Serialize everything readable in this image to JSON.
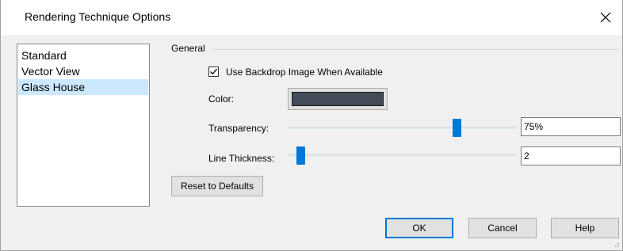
{
  "window": {
    "title": "Rendering Technique Options",
    "close_icon": "close-icon"
  },
  "techniques": {
    "items": [
      {
        "label": "Standard",
        "selected": false
      },
      {
        "label": "Vector View",
        "selected": false
      },
      {
        "label": "Glass House",
        "selected": true
      }
    ]
  },
  "general": {
    "group_label": "General",
    "backdrop": {
      "label": "Use Backdrop Image When Available",
      "checked": true
    },
    "color": {
      "label": "Color:",
      "value": "#434a58"
    },
    "transparency": {
      "label": "Transparency:",
      "value_text": "75%",
      "slider_fraction": 0.75
    },
    "line_thickness": {
      "label": "Line Thickness:",
      "value_text": "2",
      "slider_fraction": 0.04
    }
  },
  "buttons": {
    "reset": "Reset to Defaults",
    "ok": "OK",
    "cancel": "Cancel",
    "help": "Help"
  },
  "colors": {
    "accent": "#0078d7",
    "selection": "#cce8ff",
    "dialog_bg": "#f0f0f0"
  }
}
